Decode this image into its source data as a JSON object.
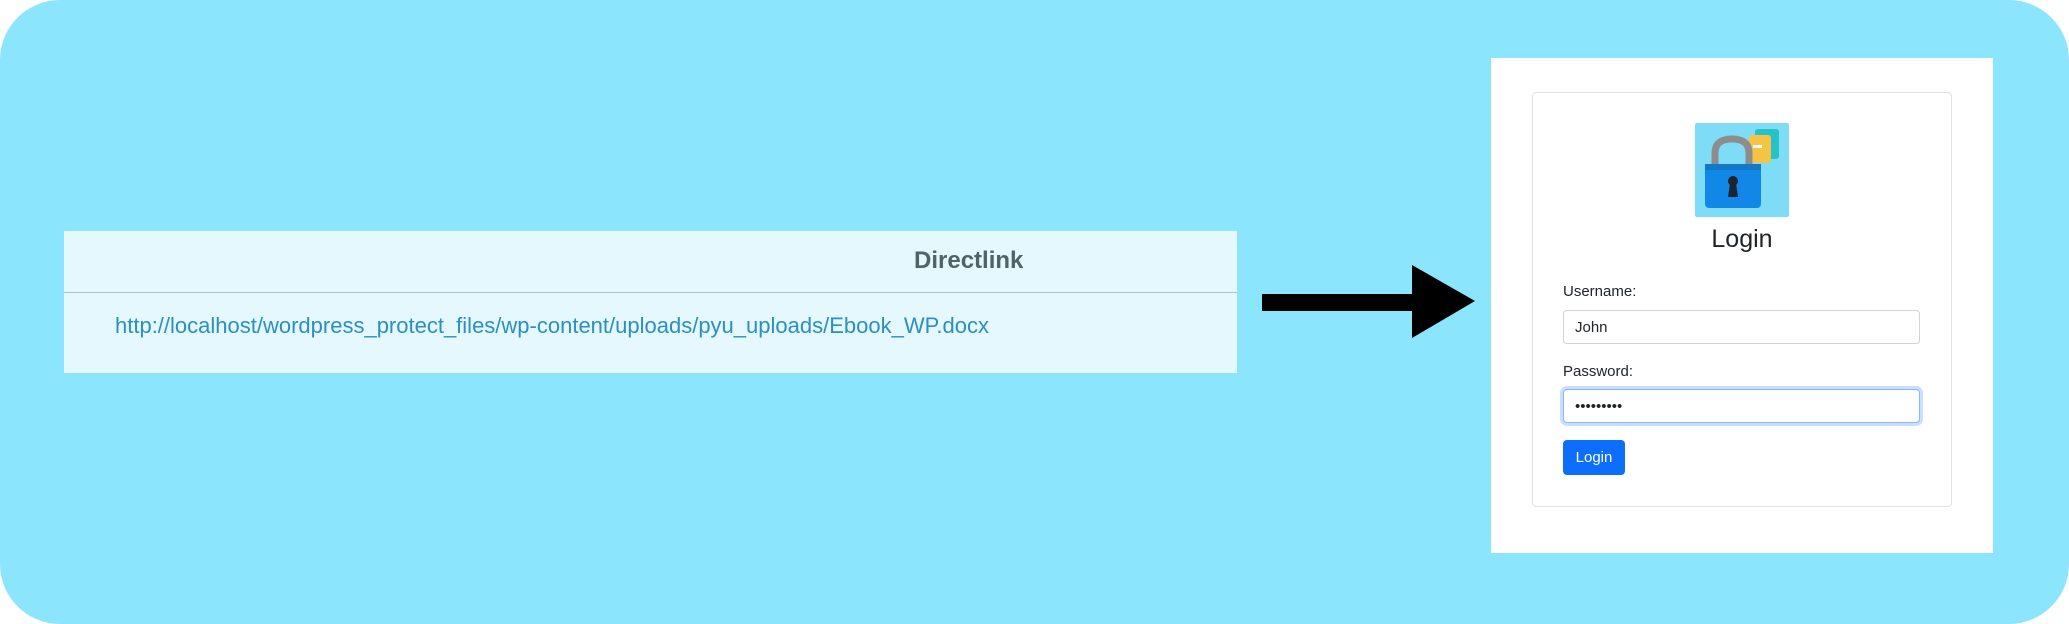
{
  "table": {
    "header": "Directlink",
    "rows": [
      {
        "link": "http://localhost/wordpress_protect_files/wp-content/uploads/pyu_uploads/Ebook_WP.docx"
      }
    ]
  },
  "arrow": {
    "icon": "right-arrow-icon",
    "color": "#000000"
  },
  "login": {
    "logo_icon": "padlock-file-icon",
    "title": "Login",
    "username_label": "Username:",
    "username_value": "John",
    "password_label": "Password:",
    "password_value": "•••••••••",
    "button_label": "Login",
    "button_color": "#0d6efd"
  },
  "colors": {
    "background": "#8ae5fd",
    "table_bg": "#e4f8fe",
    "link": "#2b8fc1",
    "header_text": "#4f636a"
  }
}
